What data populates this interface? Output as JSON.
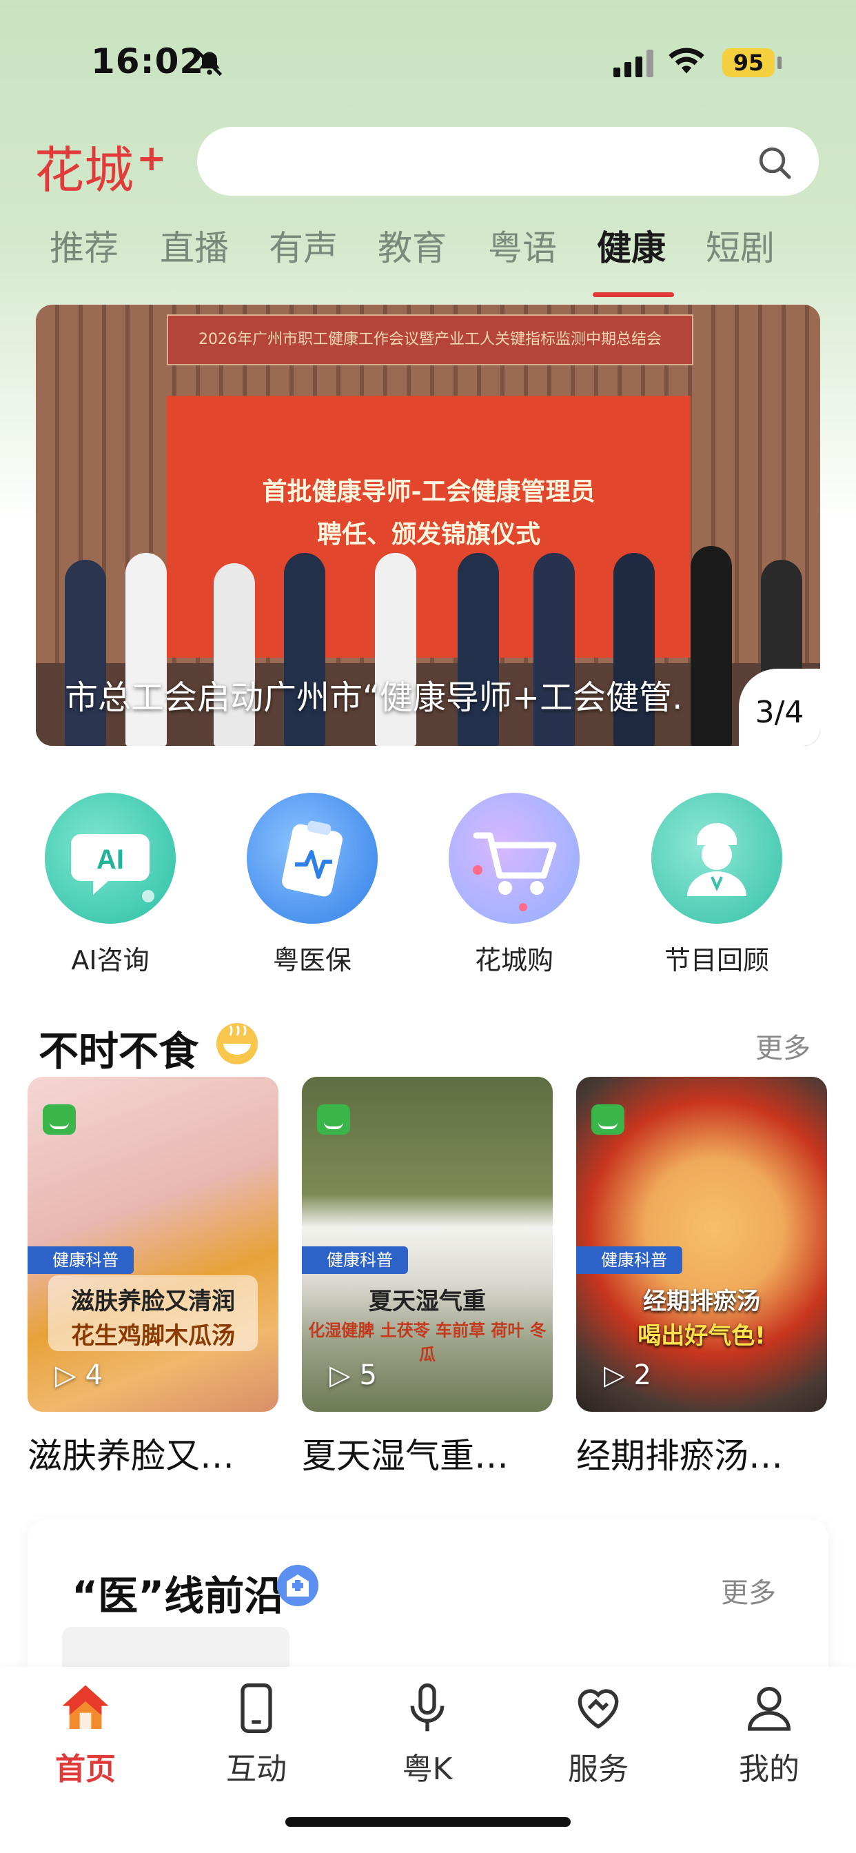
{
  "status_bar": {
    "time": "16:02",
    "battery": "95"
  },
  "header": {
    "logo": "花城",
    "logo_plus": "+",
    "search_placeholder": ""
  },
  "tabs": [
    {
      "label": "推荐"
    },
    {
      "label": "直播"
    },
    {
      "label": "有声"
    },
    {
      "label": "教育"
    },
    {
      "label": "粤语"
    },
    {
      "label": "健康",
      "active": true
    },
    {
      "label": "短剧"
    }
  ],
  "banner": {
    "caption": "市总工会启动广州市“健康导师+工会健管.",
    "counter": "3/4",
    "sign_text": "2026年广州市职工健康工作会议暨产业工人关键指标监测中期总结会",
    "screen_line1": "首批健康导师-工会健康管理员",
    "screen_line2": "聘任、颁发锦旗仪式"
  },
  "quick_links": [
    {
      "label": "AI咨询",
      "icon": "ai-chat-icon",
      "badge": "AI"
    },
    {
      "label": "粤医保",
      "icon": "medical-clipboard-icon"
    },
    {
      "label": "花城购",
      "icon": "shopping-cart-icon"
    },
    {
      "label": "节目回顾",
      "icon": "doctor-icon"
    }
  ],
  "section1": {
    "title": "不时不食",
    "more": "更多"
  },
  "videos": [
    {
      "tag": "健康科普",
      "line1": "滋肤养脸又清润",
      "line2": "花生鸡脚木瓜汤",
      "plays": "4",
      "title": "滋肤养脸又…"
    },
    {
      "tag": "健康科普",
      "line1": "夏天湿气重",
      "line2": "化湿健脾 土茯苓 车前草 荷叶 冬瓜",
      "plays": "5",
      "title": "夏天湿气重…"
    },
    {
      "tag": "健康科普",
      "line1": "经期排瘀汤",
      "line2": "喝出好气色!",
      "plays": "2",
      "title": "经期排瘀汤…"
    }
  ],
  "section2": {
    "title": "“医”线前沿",
    "more": "更多"
  },
  "bottom_nav": [
    {
      "label": "首页",
      "icon": "home-icon",
      "active": true
    },
    {
      "label": "互动",
      "icon": "phone-icon"
    },
    {
      "label": "粤K",
      "icon": "microphone-icon"
    },
    {
      "label": "服务",
      "icon": "heart-handshake-icon"
    },
    {
      "label": "我的",
      "icon": "user-icon"
    }
  ],
  "colors": {
    "accent": "#e03a3a",
    "tag_blue": "#2d62c9",
    "header_green": "#c9e3c0"
  }
}
